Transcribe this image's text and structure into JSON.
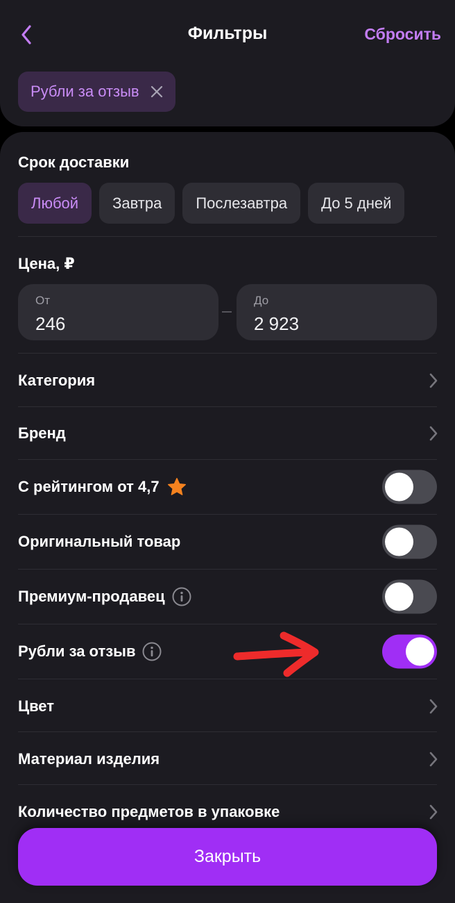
{
  "header": {
    "title": "Фильтры",
    "reset_label": "Сбросить",
    "back_icon": "chevron-left-icon"
  },
  "active_filters": [
    {
      "label": "Рубли за отзыв",
      "icon": "close-icon"
    }
  ],
  "delivery": {
    "title": "Срок доставки",
    "options": [
      "Любой",
      "Завтра",
      "Послезавтра",
      "До 5 дней"
    ],
    "selected": "Любой"
  },
  "price": {
    "title": "Цена, ₽",
    "from_label": "От",
    "from_value": "246",
    "to_label": "До",
    "to_value": "2 923"
  },
  "rows": {
    "category": "Категория",
    "brand": "Бренд",
    "rating": "С рейтингом от 4,7",
    "original": "Оригинальный товар",
    "premium": "Премиум-продавец",
    "rubles": "Рубли за отзыв",
    "color": "Цвет",
    "material": "Материал изделия",
    "quantity": "Количество предметов в упаковке"
  },
  "toggles": {
    "rating": false,
    "original": false,
    "premium": false,
    "rubles": true
  },
  "footer": {
    "close_label": "Закрыть"
  },
  "colors": {
    "accent": "#a02ef5",
    "accent_text": "#c37df4",
    "surface": "#1c1b21",
    "chip": "#2e2d34",
    "star": "#f5821f",
    "annotation_arrow": "#ee2b2b"
  }
}
